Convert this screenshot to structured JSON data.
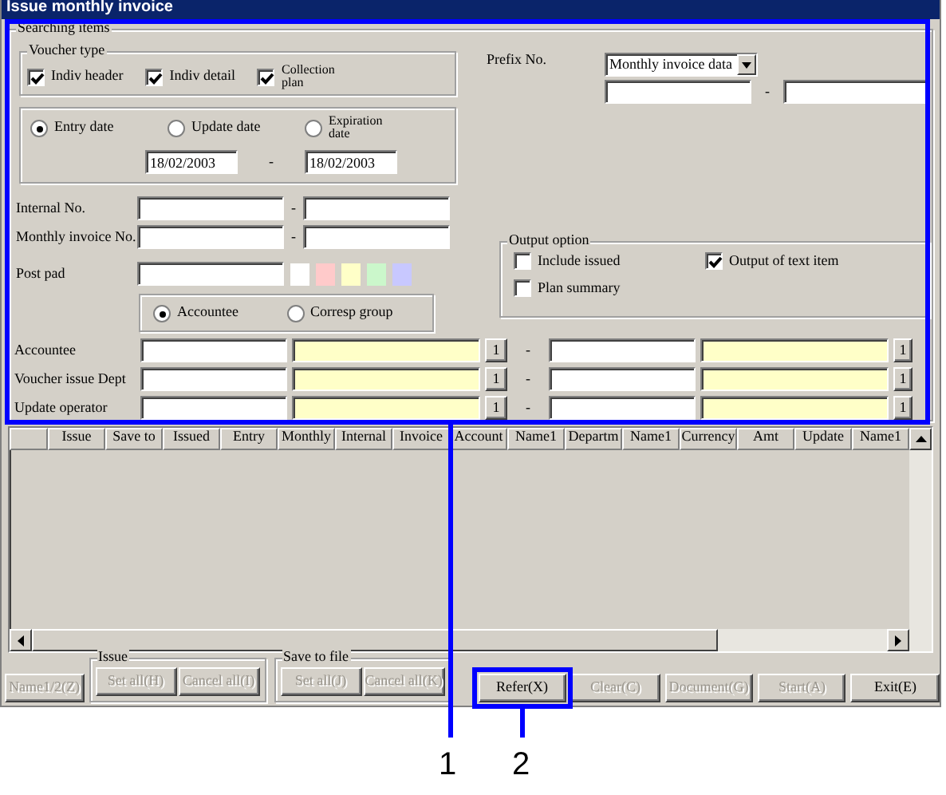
{
  "window": {
    "title": "Issue monthly invoice"
  },
  "search": {
    "title": "Searching items",
    "voucher_type": {
      "title": "Voucher type",
      "options": [
        {
          "label": "Indiv header",
          "checked": true
        },
        {
          "label": "Indiv detail",
          "checked": true
        },
        {
          "label": "Collection plan",
          "checked": true
        }
      ]
    },
    "date_type": {
      "options": [
        {
          "label": "Entry date",
          "selected": true
        },
        {
          "label": "Update date",
          "selected": false
        },
        {
          "label": "Expiration date",
          "selected": false
        }
      ],
      "from": "18/02/2003",
      "separator": "-",
      "to": "18/02/2003"
    },
    "ranges": [
      {
        "label": "Internal No.",
        "separator": "-"
      },
      {
        "label": "Monthly invoice No.",
        "separator": "-"
      }
    ],
    "post_pad": {
      "label": "Post pad",
      "swatches": [
        {
          "color": "#ffffff"
        },
        {
          "color": "#ffcaca"
        },
        {
          "color": "#ffffc8"
        },
        {
          "color": "#cbf7cb"
        },
        {
          "color": "#c8c8ff"
        }
      ]
    },
    "target": {
      "options": [
        {
          "label": "Accountee",
          "selected": true
        },
        {
          "label": "Corresp group",
          "selected": false
        }
      ]
    },
    "prefix": {
      "label": "Prefix No.",
      "value": "Monthly invoice data",
      "separator": "-"
    },
    "output_option": {
      "title": "Output option",
      "options": [
        {
          "label": "Include issued",
          "checked": false
        },
        {
          "label": "Output of text item",
          "checked": true
        },
        {
          "label": "Plan summary",
          "checked": false
        }
      ]
    },
    "lookups": [
      {
        "label": "Accountee",
        "button": "1",
        "separator": "-",
        "button_2": "1"
      },
      {
        "label": "Voucher issue Dept",
        "button": "1",
        "separator": "-",
        "button_2": "1"
      },
      {
        "label": "Update operator",
        "button": "1",
        "separator": "-",
        "button_2": "1"
      }
    ]
  },
  "grid": {
    "columns": [
      "Issue",
      "Save to",
      "Issued",
      "Entry",
      "Monthly",
      "Internal",
      "Invoice",
      "Account",
      "Name1",
      "Departm",
      "Name1",
      "Currency",
      "Amt",
      "Update",
      "Name1"
    ]
  },
  "buttons": [
    {
      "kind": "button",
      "label": "Name1/2(Z)",
      "disabled": true
    },
    {
      "kind": "group",
      "title": "Issue",
      "buttons": [
        {
          "label": "Set all(H)",
          "disabled": true
        },
        {
          "label": "Cancel all(I)",
          "disabled": true
        }
      ]
    },
    {
      "kind": "group",
      "title": "Save to file",
      "buttons": [
        {
          "label": "Set all(J)",
          "disabled": true
        },
        {
          "label": "Cancel all(K)",
          "disabled": true
        }
      ]
    },
    {
      "kind": "button",
      "label": "Refer(X)",
      "disabled": false
    },
    {
      "kind": "button",
      "label": "Clear(C)",
      "disabled": true
    },
    {
      "kind": "button",
      "label": "Document(G)",
      "disabled": true
    },
    {
      "kind": "button",
      "label": "Start(A)",
      "disabled": true
    },
    {
      "kind": "button",
      "label": "Exit(E)",
      "disabled": false
    }
  ],
  "callouts": [
    {
      "label": "1"
    },
    {
      "label": "2"
    }
  ]
}
